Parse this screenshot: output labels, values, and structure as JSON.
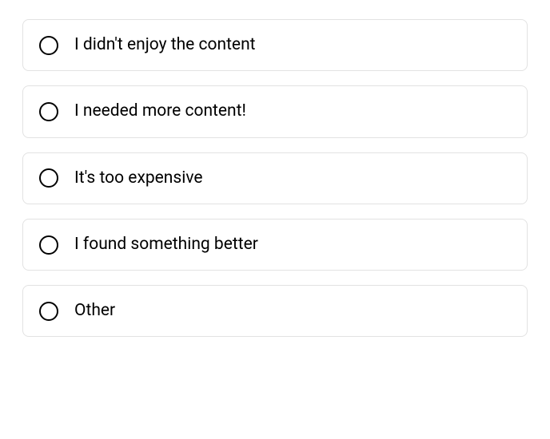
{
  "options": [
    {
      "label": "I didn't enjoy the content"
    },
    {
      "label": "I needed more content!"
    },
    {
      "label": "It's too expensive"
    },
    {
      "label": "I found something better"
    },
    {
      "label": "Other"
    }
  ]
}
